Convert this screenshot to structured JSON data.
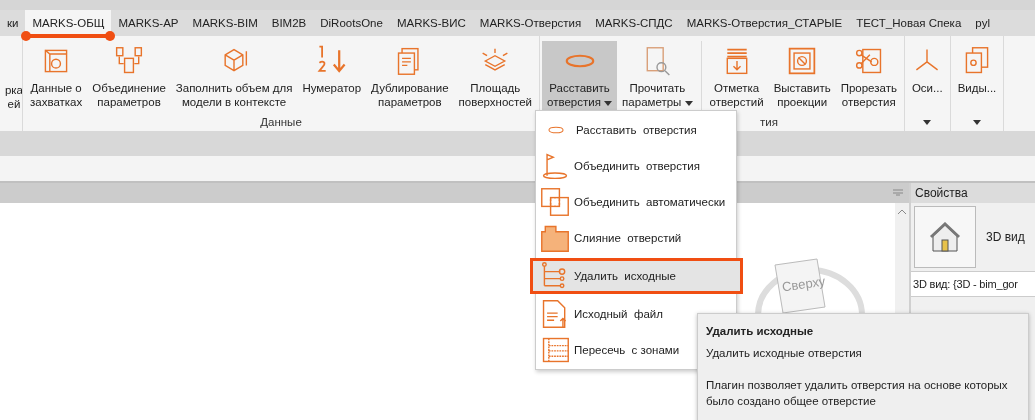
{
  "tabs": [
    {
      "label": "ки",
      "selected": false
    },
    {
      "label": "MARKS-ОБЩ",
      "selected": true
    },
    {
      "label": "MARKS-АР",
      "selected": false
    },
    {
      "label": "MARKS-BIM",
      "selected": false
    },
    {
      "label": "BIM2B",
      "selected": false
    },
    {
      "label": "DiRootsOne",
      "selected": false
    },
    {
      "label": "MARKS-ВИС",
      "selected": false
    },
    {
      "label": "MARKS-Отверстия",
      "selected": false
    },
    {
      "label": "MARKS-СПДС",
      "selected": false
    },
    {
      "label": "MARKS-Отверстия_СТАРЫЕ",
      "selected": false
    },
    {
      "label": "ТЕСТ_Новая Спека",
      "selected": false
    },
    {
      "label": "pyl",
      "selected": false
    }
  ],
  "ribbon": {
    "partial_button": {
      "lines": [
        "рка",
        "ей"
      ]
    },
    "groups": [
      {
        "label": "Данные",
        "label_partial": false,
        "buttons": [
          {
            "kind": "box",
            "lines": [
              "Данные о",
              "захватках"
            ],
            "pressed": false,
            "dropdown": false
          },
          {
            "kind": "merge",
            "lines": [
              "Объединение",
              "параметров"
            ],
            "pressed": false,
            "dropdown": false
          },
          {
            "kind": "cube",
            "lines": [
              "Заполнить объем для",
              "модели в контексте"
            ],
            "pressed": false,
            "dropdown": false
          },
          {
            "kind": "numerator",
            "lines": [
              "Нумератор"
            ],
            "pressed": false,
            "dropdown": false
          },
          {
            "kind": "copy",
            "lines": [
              "Дублирование",
              "параметров"
            ],
            "pressed": false,
            "dropdown": false
          },
          {
            "kind": "layers",
            "lines": [
              "Площадь",
              "поверхностей"
            ],
            "pressed": false,
            "dropdown": false
          }
        ]
      },
      {
        "label": "тия",
        "label_partial": true,
        "buttons": [
          {
            "kind": "ellipse",
            "lines": [
              "Расставить",
              "отверстия"
            ],
            "pressed": true,
            "dropdown": true
          },
          {
            "kind": "read",
            "lines": [
              "Прочитать",
              "параметры"
            ],
            "pressed": false,
            "dropdown": true
          },
          {
            "kind": "separator"
          },
          {
            "kind": "mark",
            "lines": [
              "Отметка",
              "отверстий"
            ],
            "pressed": false,
            "dropdown": false
          },
          {
            "kind": "projection",
            "lines": [
              "Выставить",
              "проекции"
            ],
            "pressed": false,
            "dropdown": false
          },
          {
            "kind": "cut",
            "lines": [
              "Прорезать",
              "отверстия"
            ],
            "pressed": false,
            "dropdown": false
          }
        ]
      },
      {
        "panel_menu": true,
        "buttons": [
          {
            "kind": "axes",
            "lines": [
              "Оси..."
            ],
            "pressed": false,
            "dropdown": false
          }
        ]
      },
      {
        "panel_menu": true,
        "buttons": [
          {
            "kind": "views",
            "lines": [
              "Виды..."
            ],
            "pressed": false,
            "dropdown": false
          }
        ]
      }
    ]
  },
  "menu": {
    "items": [
      {
        "kind": "ellipse",
        "label": "Расставить  отверстия",
        "selected": false
      },
      {
        "kind": "flag",
        "label": "Объединить  отверстия",
        "selected": false
      },
      {
        "kind": "squares",
        "label": "Объединить  автоматически",
        "selected": false
      },
      {
        "kind": "hatch",
        "label": "Слияние  отверстий",
        "selected": false
      },
      {
        "kind": "tree",
        "label": "Удалить  исходные",
        "selected": true
      },
      {
        "kind": "file",
        "label": "Исходный  файл",
        "selected": false
      },
      {
        "kind": "grid",
        "label": "Пересечь  с зонами",
        "selected": false
      }
    ]
  },
  "view": {
    "cube_label": "Сверху"
  },
  "properties": {
    "title": "Свойства",
    "type_label": "3D вид",
    "instance": "3D вид: {3D - bim_gor"
  },
  "tooltip": {
    "title": "Удалить исходные",
    "subtitle": "Удалить исходные отверстия",
    "description": "Плагин позволяет удалить отверстия на основе которых было создано общее отверстие"
  }
}
